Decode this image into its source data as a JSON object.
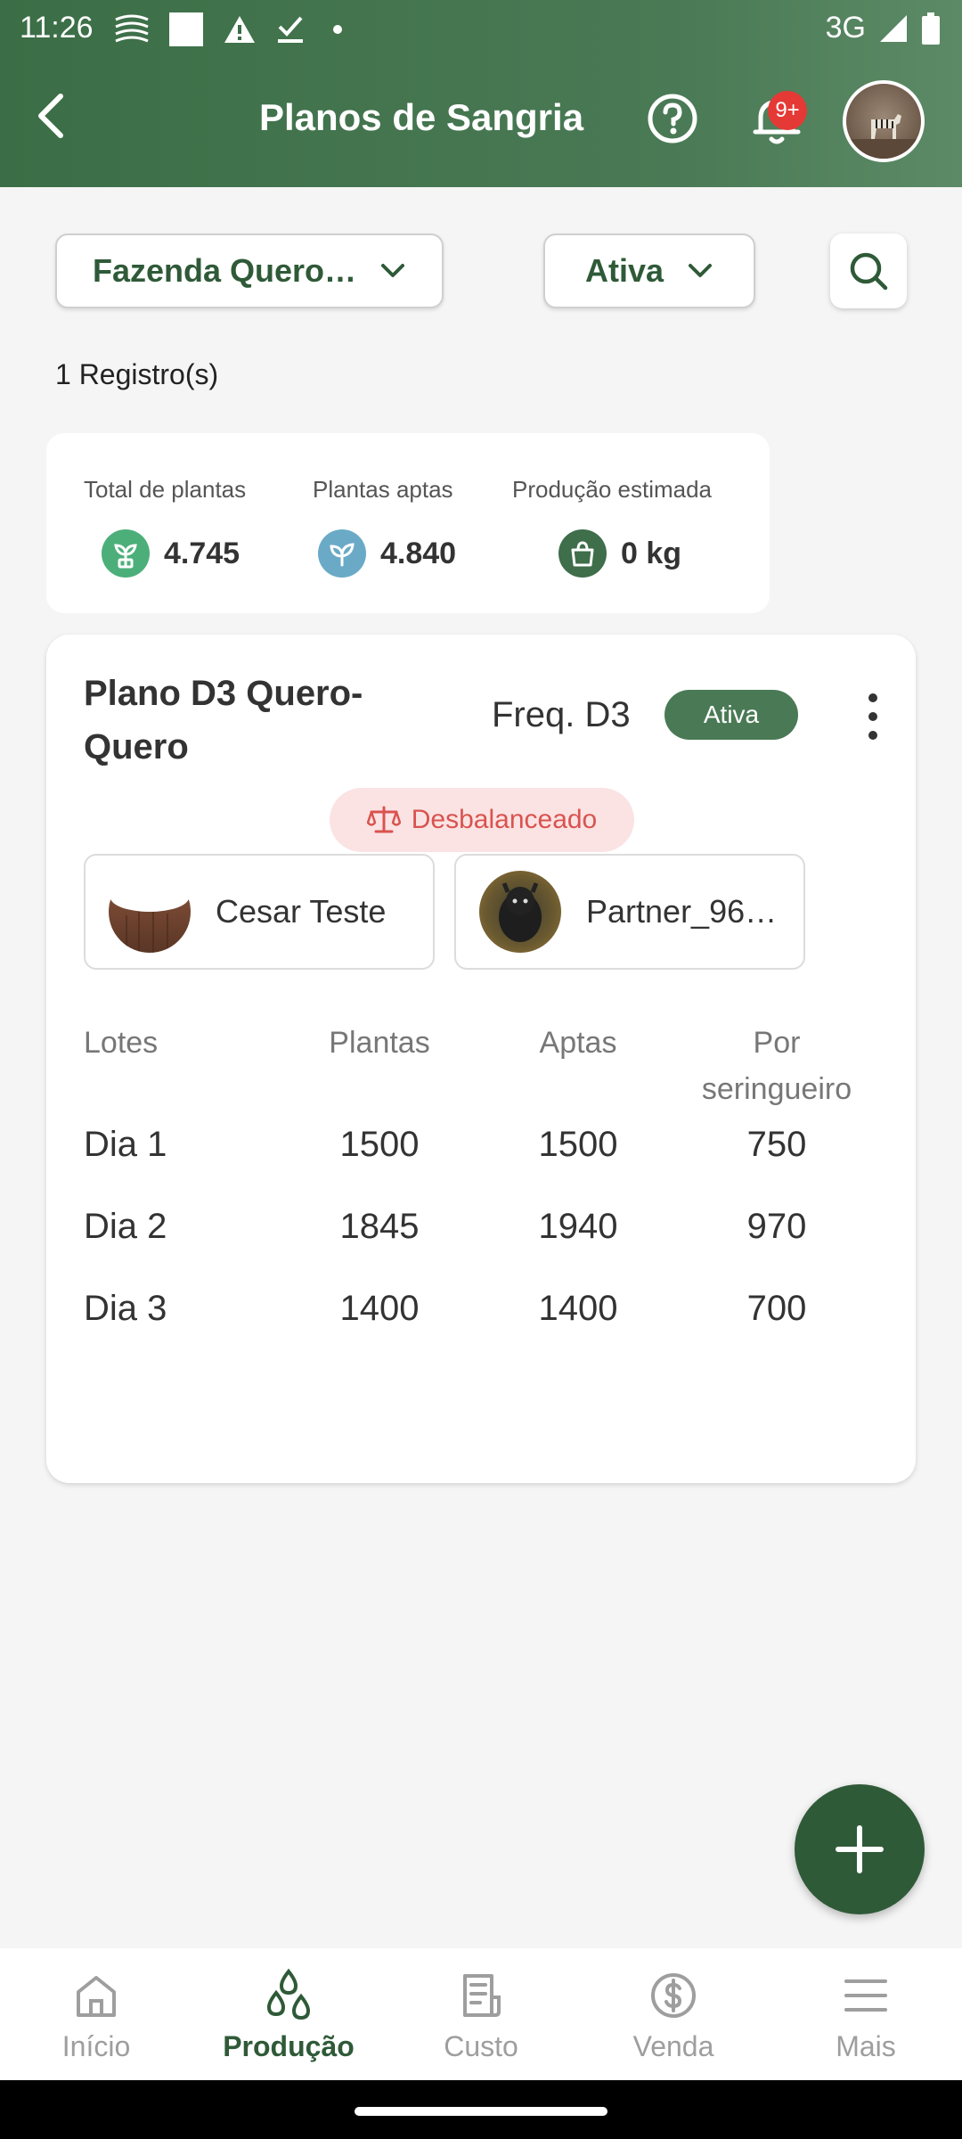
{
  "status_bar": {
    "time": "11:26",
    "network": "3G"
  },
  "header": {
    "title": "Planos de Sangria",
    "notification_count": "9+"
  },
  "filters": {
    "farm": "Fazenda Quero…",
    "status": "Ativa"
  },
  "records_count": "1 Registro(s)",
  "stats": [
    {
      "label": "Total de plantas",
      "value": "4.745",
      "icon": "sprout-icon",
      "color": "#4caf7a"
    },
    {
      "label": "Plantas aptas",
      "value": "4.840",
      "icon": "leaf-icon",
      "color": "#6aaac6"
    },
    {
      "label": "Produção estimada",
      "value": "0 kg",
      "icon": "bag-icon",
      "color": "#3f6e4a"
    }
  ],
  "plan": {
    "name": "Plano D3 Quero-Quero",
    "frequency": "Freq. D3",
    "status": "Ativa",
    "balance_tag": "Desbalanceado",
    "people": [
      {
        "name": "Cesar Teste"
      },
      {
        "name": "Partner_96…"
      }
    ],
    "table": {
      "headers": [
        "Lotes",
        "Plantas",
        "Aptas",
        "Por seringueiro"
      ],
      "rows": [
        [
          "Dia 1",
          "1500",
          "1500",
          "750"
        ],
        [
          "Dia 2",
          "1845",
          "1940",
          "970"
        ],
        [
          "Dia 3",
          "1400",
          "1400",
          "700"
        ]
      ]
    }
  },
  "bottom_nav": [
    {
      "label": "Início",
      "icon": "home-icon"
    },
    {
      "label": "Produção",
      "icon": "drops-icon",
      "active": true
    },
    {
      "label": "Custo",
      "icon": "receipt-icon"
    },
    {
      "label": "Venda",
      "icon": "dollar-icon"
    },
    {
      "label": "Mais",
      "icon": "menu-icon"
    }
  ],
  "colors": {
    "primary": "#2f5a38",
    "header": "#3b6e46",
    "danger": "#d9534f",
    "badge": "#e53935"
  }
}
